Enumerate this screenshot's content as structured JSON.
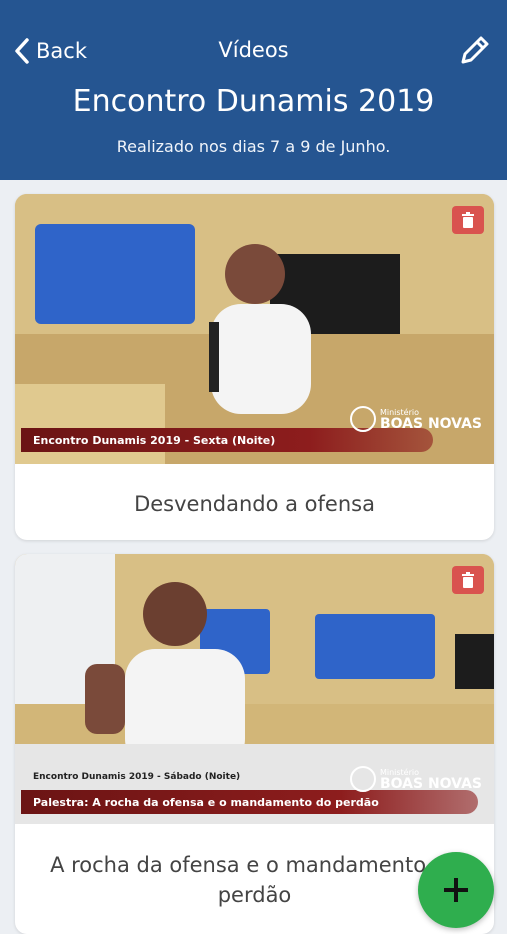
{
  "header": {
    "back_label": "Back",
    "nav_title": "Vídeos",
    "title": "Encontro Dunamis 2019",
    "subtitle": "Realizado nos dias 7 a 9 de Junho.",
    "background": "#255591"
  },
  "videos": [
    {
      "title": "Desvendando a ofensa",
      "lower_third": "Encontro Dunamis 2019 - Sexta (Noite)",
      "logo_small": "Ministério",
      "logo_big": "BOAS NOVAS"
    },
    {
      "title": "A rocha da ofensa e o mandamento do perdão",
      "lower_third_top": "Encontro Dunamis 2019 - Sábado (Noite)",
      "lower_third": "Palestra: A rocha da ofensa e o mandamento do perdão",
      "logo_small": "Ministério",
      "logo_big": "BOAS NOVAS"
    }
  ],
  "colors": {
    "delete": "#d9534f",
    "fab": "#2fae4e"
  },
  "icons": [
    "chevron-left-icon",
    "pencil-icon",
    "trash-icon",
    "plus-icon"
  ]
}
